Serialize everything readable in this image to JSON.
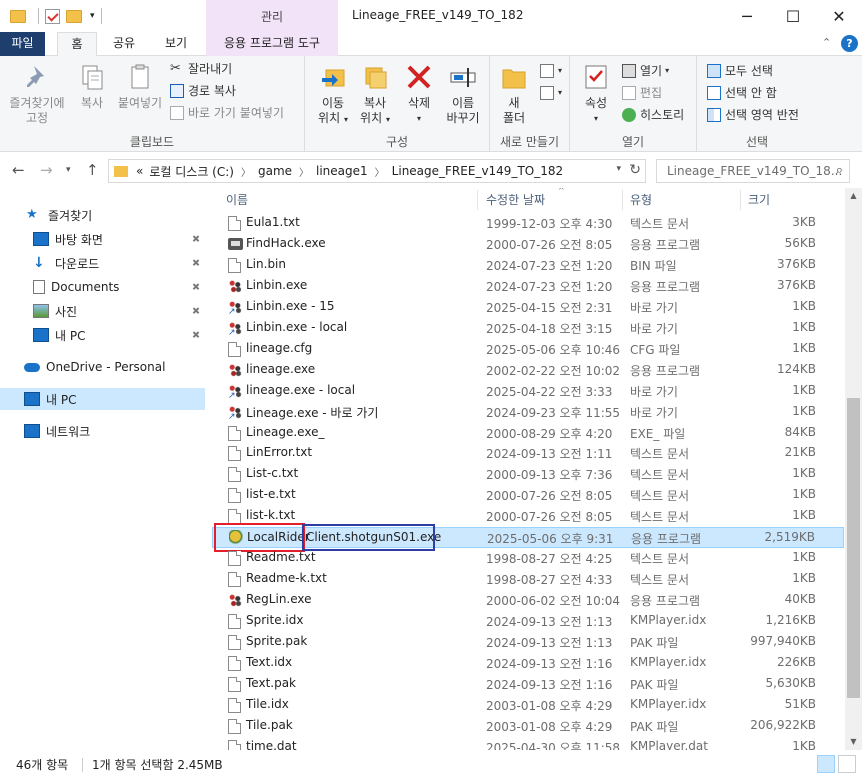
{
  "window": {
    "title": "Lineage_FREE_v149_TO_182",
    "contextual_tab_header": "관리",
    "controls": {
      "minimize": "─",
      "maximize": "☐",
      "close": "✕"
    }
  },
  "ribbon_tabs": {
    "file": "파일",
    "home": "홈",
    "share": "공유",
    "view": "보기",
    "app_tools": "응용 프로그램 도구"
  },
  "ribbon": {
    "clipboard": {
      "label": "클립보드",
      "pin": "즐겨찾기에\n고정",
      "pin_line1": "즐겨찾기에",
      "pin_line2": "고정",
      "copy": "복사",
      "paste": "붙여넣기",
      "cut": "잘라내기",
      "copy_path": "경로 복사",
      "paste_shortcut": "바로 가기 붙여넣기"
    },
    "organize": {
      "label": "구성",
      "move_line1": "이동",
      "move_line2": "위치",
      "copy_line1": "복사",
      "copy_line2": "위치",
      "delete": "삭제",
      "rename_line1": "이름",
      "rename_line2": "바꾸기"
    },
    "new": {
      "label": "새로 만들기",
      "folder_line1": "새",
      "folder_line2": "폴더"
    },
    "open": {
      "label": "열기",
      "properties": "속성",
      "open": "열기",
      "edit": "편집",
      "history": "히스토리"
    },
    "select": {
      "label": "선택",
      "select_all": "모두 선택",
      "select_none": "선택 안 함",
      "invert": "선택 영역 반전"
    }
  },
  "address": {
    "overflow": "«",
    "crumbs": [
      "로컬 디스크 (C:)",
      "game",
      "lineage1",
      "Lineage_FREE_v149_TO_182"
    ],
    "search_placeholder": "Lineage_FREE_v149_TO_18..."
  },
  "nav": {
    "quick_access": "즐겨찾기",
    "items": [
      "바탕 화면",
      "다운로드",
      "Documents",
      "사진",
      "내 PC"
    ],
    "onedrive": "OneDrive - Personal",
    "this_pc": "내 PC",
    "network": "네트워크"
  },
  "columns": {
    "name": "이름",
    "date": "수정한 날짜",
    "type": "유형",
    "size": "크기"
  },
  "files": [
    {
      "name": "Eula1.txt",
      "date": "1999-12-03 오후 4:30",
      "type": "텍스트 문서",
      "size": "3KB",
      "icon": "doc"
    },
    {
      "name": "FindHack.exe",
      "date": "2000-07-26 오전 8:05",
      "type": "응용 프로그램",
      "size": "56KB",
      "icon": "app"
    },
    {
      "name": "Lin.bin",
      "date": "2024-07-23 오전 1:20",
      "type": "BIN 파일",
      "size": "376KB",
      "icon": "doc"
    },
    {
      "name": "Linbin.exe",
      "date": "2024-07-23 오전 1:20",
      "type": "응용 프로그램",
      "size": "376KB",
      "icon": "exe"
    },
    {
      "name": "Linbin.exe - 15",
      "date": "2025-04-15 오전 2:31",
      "type": "바로 가기",
      "size": "1KB",
      "icon": "exe lnk"
    },
    {
      "name": "Linbin.exe - local",
      "date": "2025-04-18 오전 3:15",
      "type": "바로 가기",
      "size": "1KB",
      "icon": "exe lnk"
    },
    {
      "name": "lineage.cfg",
      "date": "2025-05-06 오후 10:46",
      "type": "CFG 파일",
      "size": "1KB",
      "icon": "doc"
    },
    {
      "name": "lineage.exe",
      "date": "2002-02-22 오전 10:02",
      "type": "응용 프로그램",
      "size": "124KB",
      "icon": "exe"
    },
    {
      "name": "lineage.exe - local",
      "date": "2025-04-22 오전 3:33",
      "type": "바로 가기",
      "size": "1KB",
      "icon": "exe lnk"
    },
    {
      "name": "Lineage.exe - 바로 가기",
      "date": "2024-09-23 오후 11:55",
      "type": "바로 가기",
      "size": "1KB",
      "icon": "exe lnk"
    },
    {
      "name": "Lineage.exe_",
      "date": "2000-08-29 오후 4:20",
      "type": "EXE_ 파일",
      "size": "84KB",
      "icon": "doc"
    },
    {
      "name": "LinError.txt",
      "date": "2024-09-13 오전 1:11",
      "type": "텍스트 문서",
      "size": "21KB",
      "icon": "doc"
    },
    {
      "name": "List-c.txt",
      "date": "2000-09-13 오후 7:36",
      "type": "텍스트 문서",
      "size": "1KB",
      "icon": "doc"
    },
    {
      "name": "list-e.txt",
      "date": "2000-07-26 오전 8:05",
      "type": "텍스트 문서",
      "size": "1KB",
      "icon": "doc"
    },
    {
      "name": "list-k.txt",
      "date": "2000-07-26 오전 8:05",
      "type": "텍스트 문서",
      "size": "1KB",
      "icon": "doc"
    },
    {
      "name": "LocalRider Client.shotgunS01.exe",
      "name_part1": "LocalRider",
      "name_part2": "Client.shotgunS01.exe",
      "date": "2025-05-06 오후 9:31",
      "type": "응용 프로그램",
      "size": "2,519KB",
      "icon": "rider",
      "selected": true
    },
    {
      "name": "Readme.txt",
      "date": "1998-08-27 오전 4:25",
      "type": "텍스트 문서",
      "size": "1KB",
      "icon": "doc"
    },
    {
      "name": "Readme-k.txt",
      "date": "1998-08-27 오전 4:33",
      "type": "텍스트 문서",
      "size": "1KB",
      "icon": "doc"
    },
    {
      "name": "RegLin.exe",
      "date": "2000-06-02 오전 10:04",
      "type": "응용 프로그램",
      "size": "40KB",
      "icon": "exe"
    },
    {
      "name": "Sprite.idx",
      "date": "2024-09-13 오전 1:13",
      "type": "KMPlayer.idx",
      "size": "1,216KB",
      "icon": "doc"
    },
    {
      "name": "Sprite.pak",
      "date": "2024-09-13 오전 1:13",
      "type": "PAK 파일",
      "size": "997,940KB",
      "icon": "doc"
    },
    {
      "name": "Text.idx",
      "date": "2024-09-13 오전 1:16",
      "type": "KMPlayer.idx",
      "size": "226KB",
      "icon": "doc"
    },
    {
      "name": "Text.pak",
      "date": "2024-09-13 오전 1:16",
      "type": "PAK 파일",
      "size": "5,630KB",
      "icon": "doc"
    },
    {
      "name": "Tile.idx",
      "date": "2003-01-08 오후 4:29",
      "type": "KMPlayer.idx",
      "size": "51KB",
      "icon": "doc"
    },
    {
      "name": "Tile.pak",
      "date": "2003-01-08 오후 4:29",
      "type": "PAK 파일",
      "size": "206,922KB",
      "icon": "doc"
    },
    {
      "name": "time.dat",
      "date": "2025-04-30 오후 11:58",
      "type": "KMPlayer.dat",
      "size": "1KB",
      "icon": "doc"
    }
  ],
  "status": {
    "count": "46개 항목",
    "selection": "1개 항목 선택함 2.45MB"
  },
  "colors": {
    "accent": "#1e3f6e",
    "selection": "#cce8ff",
    "context_tab": "#f3e3f9"
  }
}
